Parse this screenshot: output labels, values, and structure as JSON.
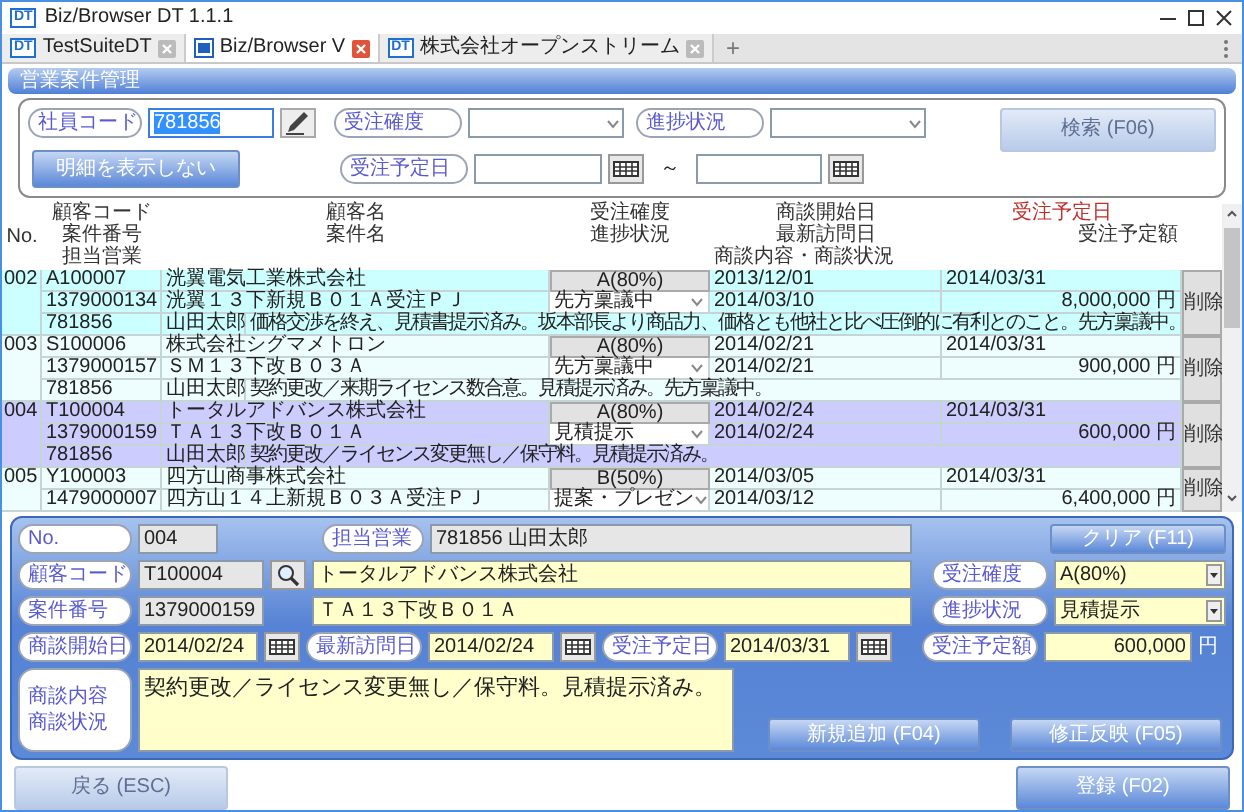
{
  "window": {
    "icon_text": "DT",
    "title": "Biz/Browser DT 1.1.1"
  },
  "tabs": [
    {
      "icon_text": "DT",
      "label": "TestSuiteDT",
      "selected": false
    },
    {
      "label": "Biz/Browser V",
      "selected": true
    },
    {
      "icon_text": "DT",
      "label": "株式会社オープンストリーム",
      "selected": false
    }
  ],
  "new_tab": "+",
  "page_title": "営業案件管理",
  "search": {
    "employee_code": {
      "label": "社員コード",
      "value": "781856",
      "value_selected": true
    },
    "certainty": {
      "label": "受注確度"
    },
    "progress": {
      "label": "進捗状況"
    },
    "search_button": {
      "label": "検索 (F06)",
      "disabled": true
    },
    "toggle_button": {
      "label": "明細を表示しない",
      "disabled": false
    },
    "order_date": {
      "label": "受注予定日",
      "separator": "～"
    }
  },
  "grid": {
    "headers": {
      "no": "No.",
      "customer_code": "顧客コード",
      "customer_name": "顧客名",
      "certainty": "受注確度",
      "start_date": "商談開始日",
      "order_date": "受注予定日",
      "case_number": "案件番号",
      "case_name": "案件名",
      "status": "進捗状況",
      "last_visit": "最新訪問日",
      "amount": "受注予定額",
      "staff": "担当営業",
      "memo": "商談内容・商談状況"
    },
    "records": [
      {
        "no": "002",
        "customer_code": "A100007",
        "customer_name": "洸翼電気工業株式会社",
        "certainty": "A(80%)",
        "start_date": "2013/12/01",
        "order_date": "2014/03/31",
        "case_number": "1379000134",
        "case_name": "洸翼１３下新規Ｂ０１Ａ受注ＰＪ",
        "status": "先方稟議中",
        "last_visit": "2014/03/10",
        "amount": "8,000,000 円",
        "staff_code": "781856",
        "staff_name": "山田太郎",
        "memo": "価格交渉を終え、見積書提示済み。坂本部長より商品力、価格とも他社と比べ圧倒的に有利とのこと。先方稟議中。",
        "delete": "削除",
        "selected": false
      },
      {
        "no": "003",
        "customer_code": "S100006",
        "customer_name": "株式会社シグマメトロン",
        "certainty": "A(80%)",
        "start_date": "2014/02/21",
        "order_date": "2014/03/31",
        "case_number": "1379000157",
        "case_name": "ＳＭ１３下改Ｂ０３Ａ",
        "status": "先方稟議中",
        "last_visit": "2014/02/21",
        "amount": "900,000 円",
        "staff_code": "781856",
        "staff_name": "山田太郎",
        "memo": "契約更改／来期ライセンス数合意。見積提示済み。先方稟議中。",
        "delete": "削除",
        "selected": false
      },
      {
        "no": "004",
        "customer_code": "T100004",
        "customer_name": "トータルアドバンス株式会社",
        "certainty": "A(80%)",
        "start_date": "2014/02/24",
        "order_date": "2014/03/31",
        "case_number": "1379000159",
        "case_name": "ＴＡ１３下改Ｂ０１Ａ",
        "status": "見積提示",
        "last_visit": "2014/02/24",
        "amount": "600,000 円",
        "staff_code": "781856",
        "staff_name": "山田太郎",
        "memo": "契約更改／ライセンス変更無し／保守料。見積提示済み。",
        "delete": "削除",
        "selected": true
      },
      {
        "no": "005",
        "customer_code": "Y100003",
        "customer_name": "四方山商事株式会社",
        "certainty": "B(50%)",
        "start_date": "2014/03/05",
        "order_date": "2014/03/31",
        "case_number": "1479000007",
        "case_name": "四方山１４上新規Ｂ０３Ａ受注ＰＪ",
        "status": "提案・プレゼン",
        "last_visit": "2014/03/12",
        "amount": "6,400,000 円",
        "delete": "削除",
        "selected": false
      }
    ]
  },
  "detail": {
    "no": {
      "label": "No.",
      "value": "004"
    },
    "staff": {
      "label": "担当営業",
      "value": "781856 山田太郎"
    },
    "customer_code": {
      "label": "顧客コード",
      "value": "T100004"
    },
    "customer_name": {
      "value": "トータルアドバンス株式会社"
    },
    "case_number": {
      "label": "案件番号",
      "value": "1379000159"
    },
    "case_name": {
      "value": "ＴＡ１３下改Ｂ０１Ａ"
    },
    "start_date": {
      "label": "商談開始日",
      "value": "2014/02/24"
    },
    "last_visit": {
      "label": "最新訪問日",
      "value": "2014/02/24"
    },
    "order_date": {
      "label": "受注予定日",
      "value": "2014/03/31"
    },
    "certainty": {
      "label": "受注確度",
      "value": "A(80%)"
    },
    "progress": {
      "label": "進捗状況",
      "value": "見積提示"
    },
    "amount": {
      "label": "受注予定額",
      "value": "600,000",
      "unit": "円"
    },
    "memo": {
      "label": "商談内容商談状況",
      "value": "契約更改／ライセンス変更無し／保守料。見積提示済み。"
    },
    "clear_button": {
      "label": "クリア (F11)",
      "disabled": false
    },
    "add_button": {
      "label": "新規追加 (F04)",
      "disabled": false
    },
    "update_button": {
      "label": "修正反映 (F05)",
      "disabled": false
    }
  },
  "footer": {
    "back_button": {
      "label": "戻る (ESC)",
      "disabled": true
    },
    "register_button": {
      "label": "登録 (F02)",
      "disabled": false
    }
  }
}
